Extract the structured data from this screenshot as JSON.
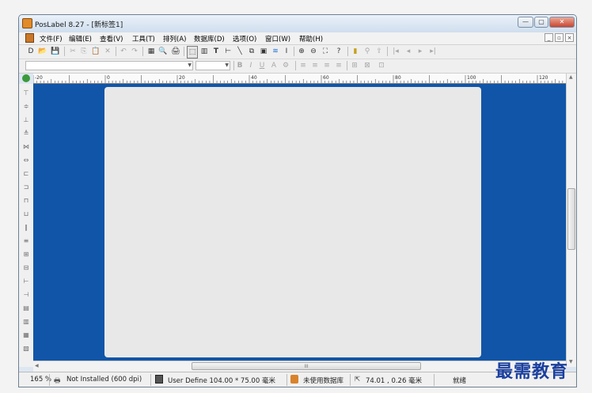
{
  "window": {
    "title": "PosLabel 8.27 - [新标签1]"
  },
  "menu": [
    "文件(F)",
    "编辑(E)",
    "查看(V)",
    "工具(T)",
    "排列(A)",
    "数据库(D)",
    "选项(O)",
    "窗口(W)",
    "帮助(H)"
  ],
  "toolbar1": [
    "D",
    "📂",
    "💾",
    "✂",
    "⎘",
    "📋",
    "✕",
    "↶",
    "↷",
    "▦",
    "🔍",
    "🖨",
    "⬚",
    "▥",
    "T",
    "⊢",
    "╲",
    "⧉",
    "▣",
    "≋",
    "I",
    "⊕",
    "⊖",
    "⛶",
    "?",
    "▮",
    "⚲",
    "⇪",
    "|◂",
    "◂",
    "▸",
    "▸|"
  ],
  "toolbar2": [
    "B",
    "I",
    "U",
    "A",
    "⚙",
    "≡",
    "≡",
    "≡",
    "≡",
    "⊞",
    "⊠",
    "⊡"
  ],
  "ruler_labels": [
    "-20",
    "0",
    "20",
    "40",
    "60",
    "80",
    "100",
    "120"
  ],
  "vertical_tools": [
    "⊤",
    "≑",
    "⊥",
    "≜",
    "⋈",
    "⇔",
    "⊏",
    "⊐",
    "⊓",
    "⊔",
    "∥",
    "≡",
    "⊞",
    "⊟",
    "⊢",
    "⊣",
    "▤",
    "▥",
    "▦",
    "▧"
  ],
  "scroll_grip": "III",
  "status": {
    "zoom": "165 %",
    "printer": "Not Installed (600 dpi)",
    "paper": "User Define  104.00 * 75.00 毫米",
    "database": "未使用数据库",
    "coords": "74.01 , 0.26 毫米",
    "ready": "就绪"
  },
  "watermark": "最需教育",
  "colors": {
    "canvas": "#1155a8",
    "paper": "#e8e8e8",
    "watermark": "#1a3f9e"
  }
}
